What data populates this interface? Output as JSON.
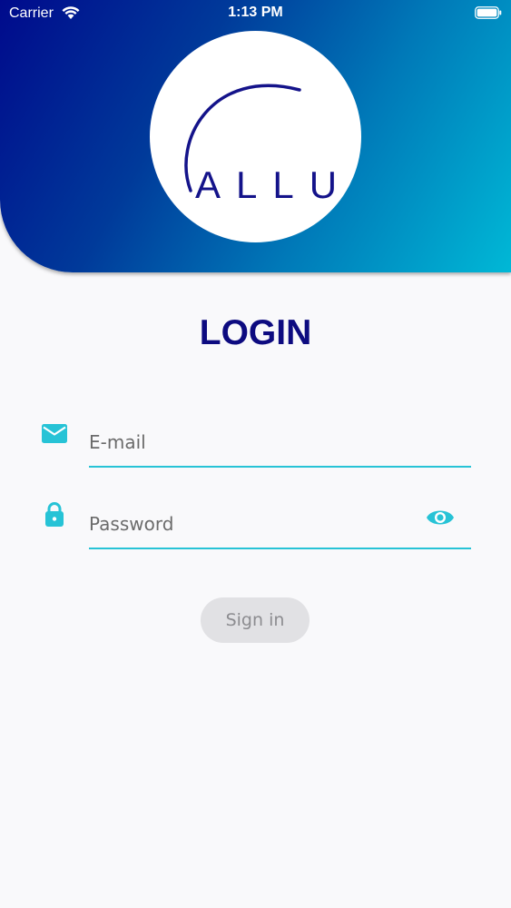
{
  "status_bar": {
    "carrier": "Carrier",
    "time": "1:13 PM"
  },
  "logo": {
    "text": "ALLU"
  },
  "login": {
    "title": "LOGIN",
    "email_placeholder": "E-mail",
    "password_placeholder": "Password",
    "signin_label": "Sign in"
  },
  "icons": {
    "email": "mail-icon",
    "password": "lock-icon",
    "toggle_visibility": "eye-icon"
  },
  "colors": {
    "accent": "#27c3d6",
    "title": "#0d0b80",
    "gradient_start": "#000a8c",
    "gradient_end": "#00b8d6",
    "button_bg": "#e1e1e4",
    "button_text": "#8c8c90"
  }
}
